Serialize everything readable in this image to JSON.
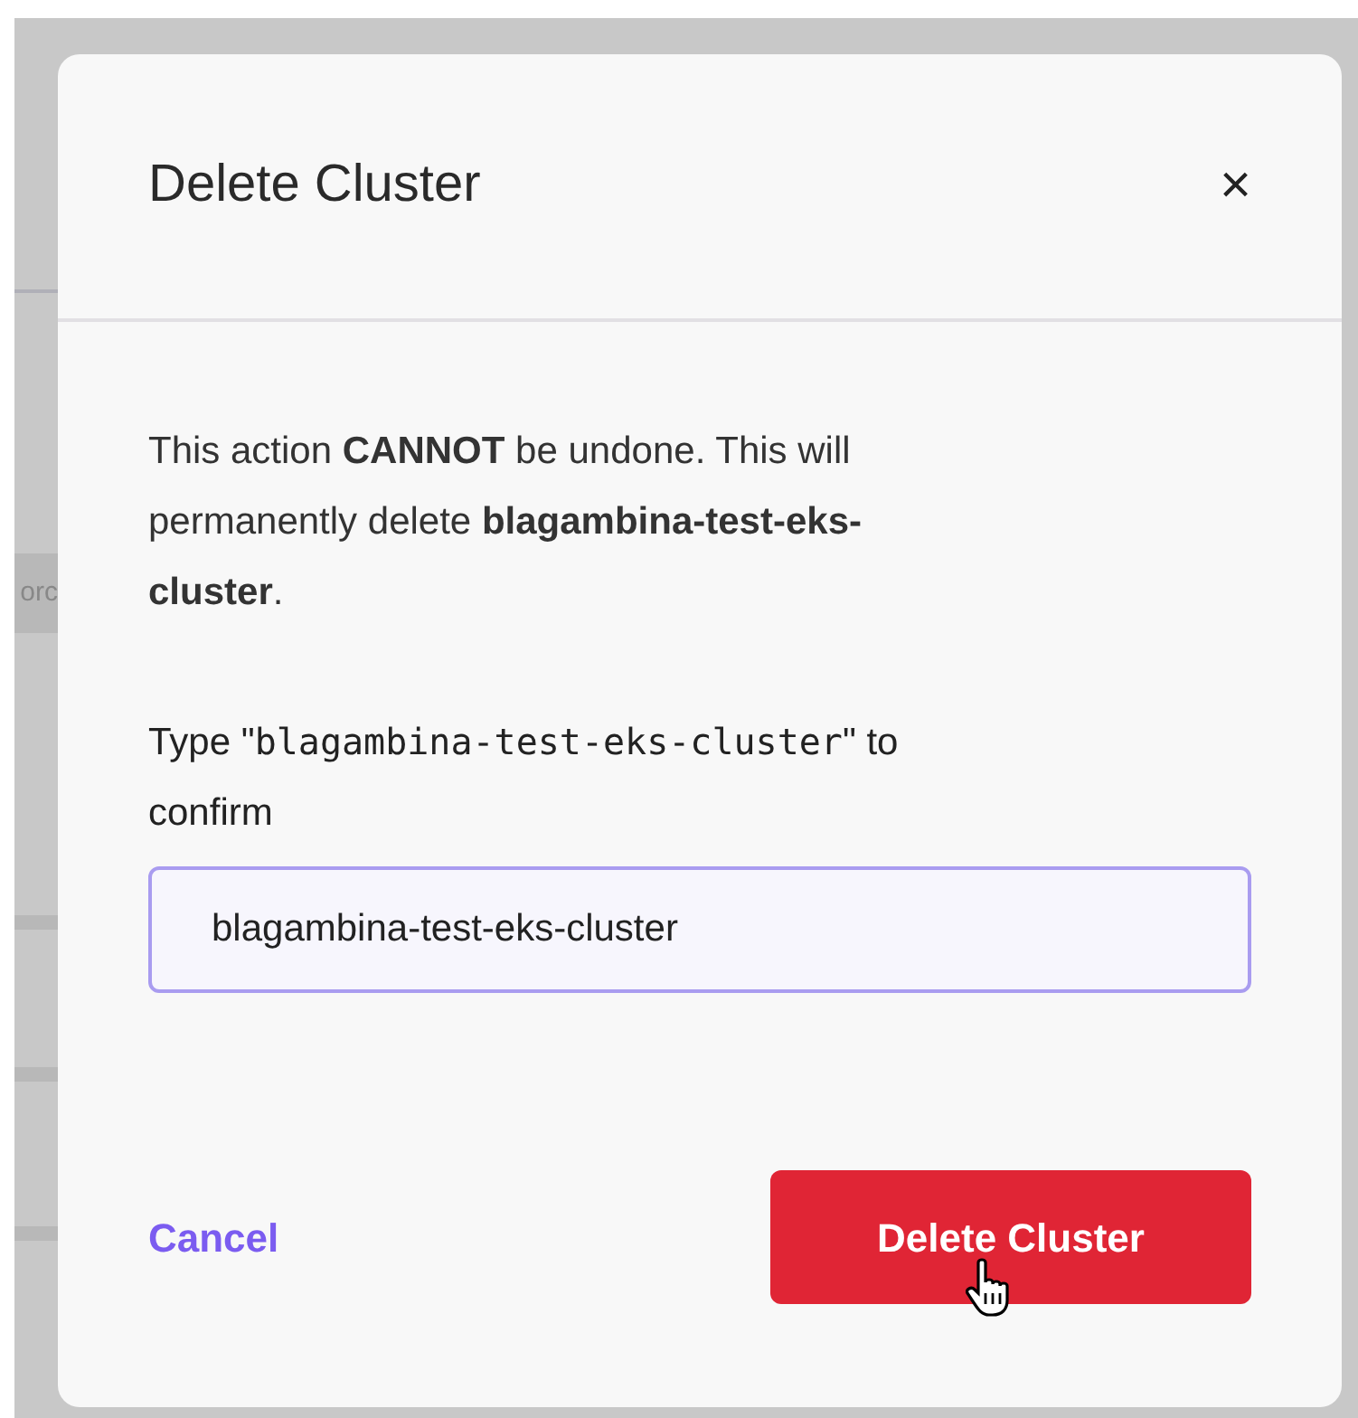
{
  "background": {
    "fragment_text": "orc"
  },
  "dialog": {
    "title": "Delete Cluster",
    "close_label": "×",
    "message": "This action **CANNOT** be undone. This will permanently delete **blagambina-test-eks-cluster**.",
    "confirm_label": {
      "before": "Type \"",
      "code": "blagambina-test-eks-cluster",
      "after": "\" to confirm"
    },
    "input": {
      "value": "blagambina-test-eks-cluster",
      "focused": true
    },
    "buttons": [
      {
        "kind": "link",
        "label": "Cancel"
      },
      {
        "kind": "danger",
        "label": "Delete Cluster",
        "hovered": true
      }
    ]
  }
}
